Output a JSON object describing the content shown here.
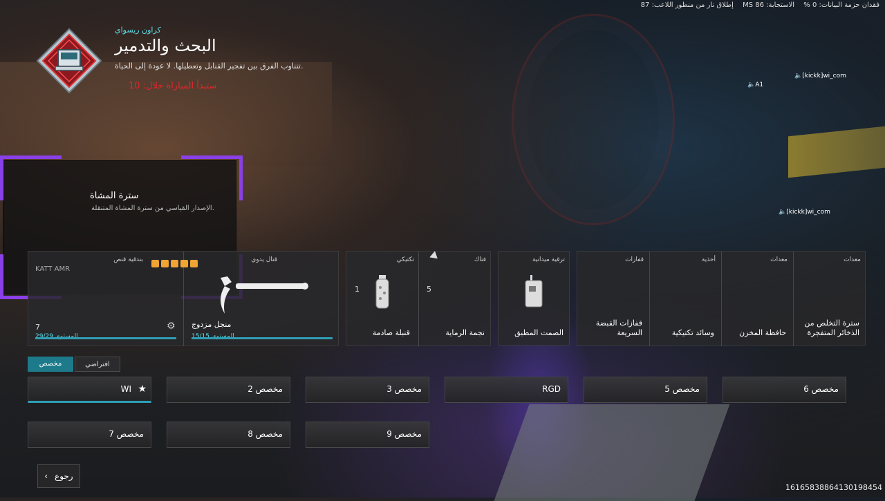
{
  "hud": {
    "packet_loss": "فقدان حزمة البيانات: 0 %",
    "latency": "الاستجابة: MS 86",
    "fire_perspective": "إطلاق نار من منظور اللاعب: 87"
  },
  "mode": {
    "map": "كراون ريسواي",
    "title": "البحث والتدمير",
    "description": "تتناوب الفرق بين تفجير القنابل وتعطيلها. لا عودة إلى الحياة.",
    "countdown": "ستبدأ المباراة خلال: 10"
  },
  "players": [
    {
      "label": "[kickk]wi_com"
    },
    {
      "label": "A1"
    },
    {
      "label": "[kickk]wi_com"
    }
  ],
  "tooltip": {
    "title": "سترة المشاة",
    "description": "الإصدار القياسي من سترة المشاة المتنقلة."
  },
  "loadout": {
    "primary": {
      "slot": "بندقية قنص",
      "name": "KATT AMR",
      "count": "7",
      "level": "المستوى 29/29",
      "level_fraction": 1.0,
      "stars": 5
    },
    "melee": {
      "slot": "قتال يدوي",
      "name": "منجل مزدوج",
      "level": "المستوى 15/15",
      "level_fraction": 1.0
    },
    "tactical": {
      "slot": "تكتيكي",
      "name": "قنبلة صادمة",
      "count": "1"
    },
    "lethal": {
      "slot": "فتاك",
      "name": "نجمة الرماية",
      "count": "5"
    },
    "field_upgrade": {
      "slot": "ترقية ميدانية",
      "name": "الصمت المطبق"
    },
    "gloves": {
      "slot": "قفازات",
      "name": "قفازات القبضة السريعة"
    },
    "boots": {
      "slot": "أحذية",
      "name": "وسائد تكتيكية"
    },
    "gear": {
      "slot": "معدات",
      "name": "حافظة المخزن"
    },
    "vest": {
      "slot": "معدات",
      "name": "سترة التخلص من الذخائر المتفجرة"
    }
  },
  "preset_tabs": {
    "custom": "مخصص",
    "default": "افتراضي"
  },
  "presets": [
    {
      "name": "WI",
      "selected": true
    },
    {
      "name": "مخصص 2"
    },
    {
      "name": "مخصص 3"
    },
    {
      "name": "RGD"
    },
    {
      "name": "مخصص 5"
    },
    {
      "name": "مخصص 6"
    },
    {
      "name": "مخصص 7"
    },
    {
      "name": "مخصص 8"
    },
    {
      "name": "مخصص 9"
    }
  ],
  "back_label": "رجوع",
  "session_id": "16165838864130198454",
  "colors": {
    "accent": "#2f9fb5",
    "purple": "#8a3fe8",
    "warning": "#e0262a",
    "highlight": "#5fe0ea",
    "star": "#f0a434"
  }
}
